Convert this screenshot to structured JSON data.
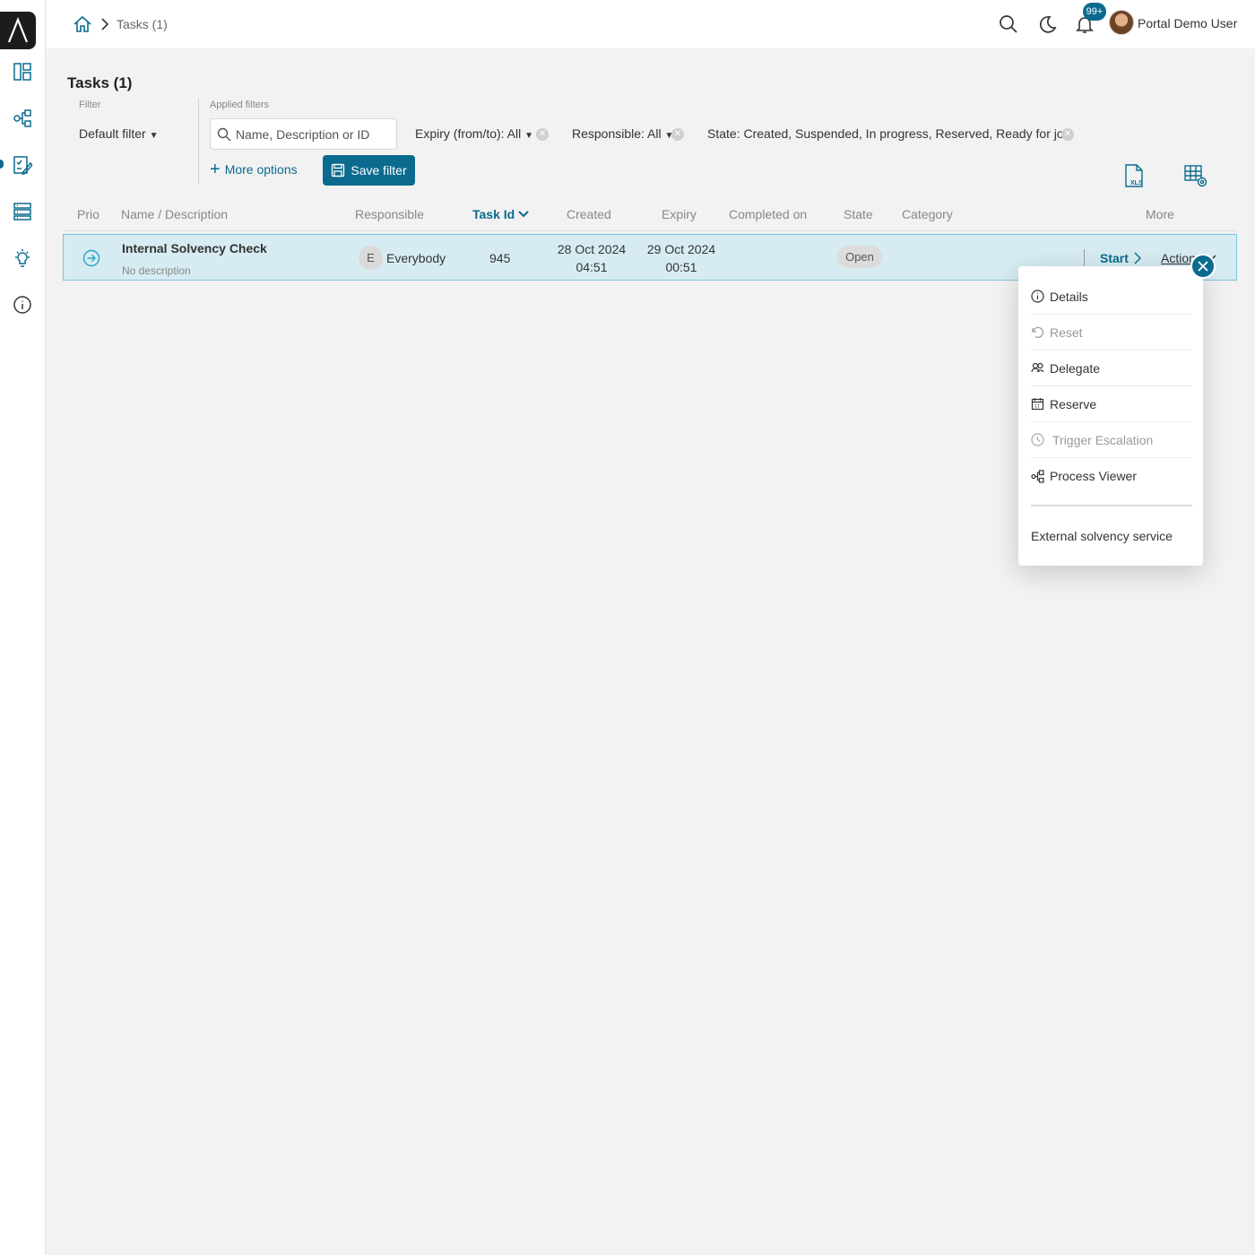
{
  "breadcrumb": {
    "current": "Tasks (1)"
  },
  "topbar": {
    "notification_badge": "99+",
    "user_name": "Portal Demo User"
  },
  "page": {
    "title": "Tasks (1)"
  },
  "filters": {
    "filter_label": "Filter",
    "default_filter": "Default filter",
    "applied_label": "Applied filters",
    "search_placeholder": "Name, Description or ID",
    "expiry": "Expiry (from/to): All",
    "responsible": "Responsible: All",
    "state": "State: Created, Suspended, In progress, Reserved, Ready for jo",
    "more_options": "More options",
    "save_filter": "Save filter"
  },
  "table": {
    "columns": {
      "prio": "Prio",
      "name": "Name / Description",
      "responsible": "Responsible",
      "task_id": "Task Id",
      "created": "Created",
      "expiry": "Expiry",
      "completed_on": "Completed on",
      "state": "State",
      "category": "Category",
      "more": "More"
    },
    "rows": [
      {
        "name": "Internal Solvency Check",
        "description": "No description",
        "responsible_initial": "E",
        "responsible": "Everybody",
        "task_id": "945",
        "created_date": "28 Oct 2024",
        "created_time": "04:51",
        "expiry_date": "29 Oct 2024",
        "expiry_time": "00:51",
        "state": "Open",
        "start": "Start",
        "actions": "Actions"
      }
    ]
  },
  "menu": {
    "items": [
      {
        "label": "Details",
        "icon": "info-icon",
        "enabled": true
      },
      {
        "label": "Reset",
        "icon": "undo-icon",
        "enabled": false
      },
      {
        "label": "Delegate",
        "icon": "users-icon",
        "enabled": true
      },
      {
        "label": "Reserve",
        "icon": "calendar-icon",
        "enabled": true
      },
      {
        "label": "Trigger Escalation",
        "icon": "clock-icon",
        "enabled": false
      },
      {
        "label": "Process Viewer",
        "icon": "process-icon",
        "enabled": true
      }
    ],
    "external": "External solvency service"
  },
  "colors": {
    "accent": "#0b6b8e",
    "row_highlight": "#d6ecf2",
    "background": "#f2f2f2"
  }
}
